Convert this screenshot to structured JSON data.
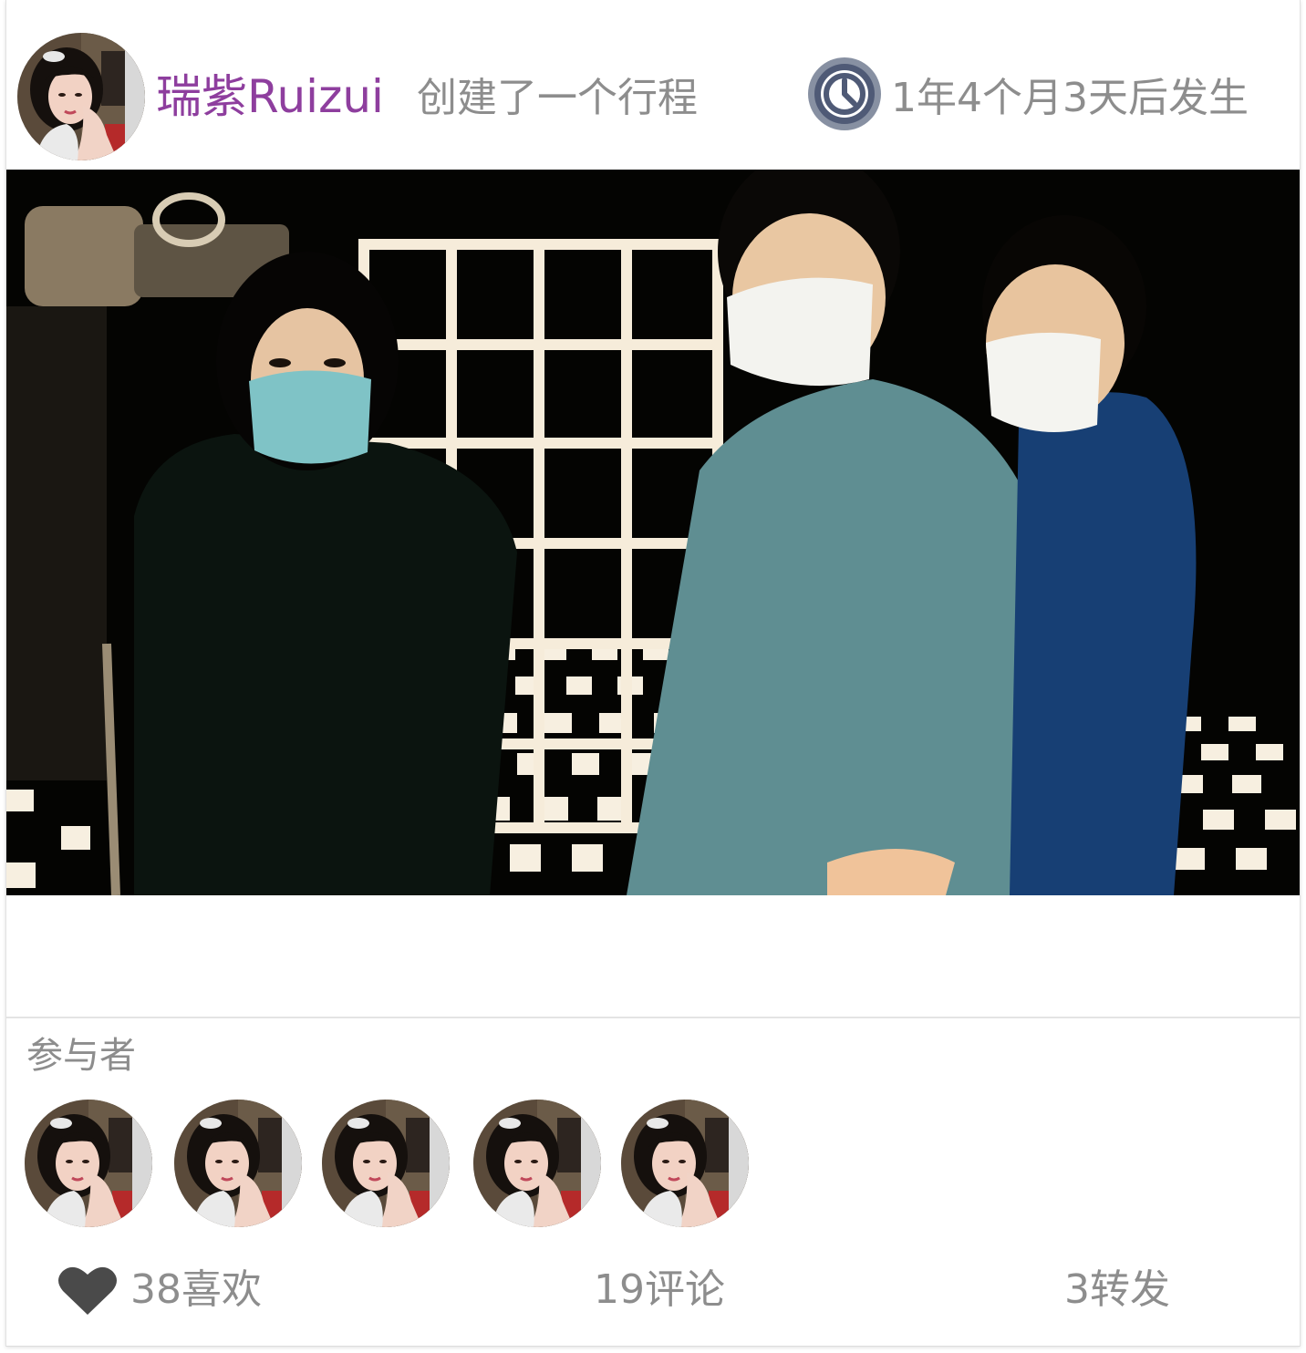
{
  "post": {
    "user_name": "瑞紫Ruizui",
    "action": "创建了一个行程",
    "time_until": "1年4个月3天后发生",
    "avatar_icon": "user-avatar-photo",
    "clock_icon": "clock-icon",
    "photo_icon": "trip-photo"
  },
  "participants": {
    "title": "参与者",
    "count_shown": 5
  },
  "stats": {
    "likes_label": "38喜欢",
    "comments_label": "19评论",
    "shares_label": "3转发",
    "heart_icon": "heart-icon"
  },
  "colors": {
    "username": "#8e3e9e",
    "muted_text": "#8d8d8d",
    "heart": "#4a4a4a",
    "clock_ring": "#8790a2",
    "clock_face": "#4f5a76"
  }
}
